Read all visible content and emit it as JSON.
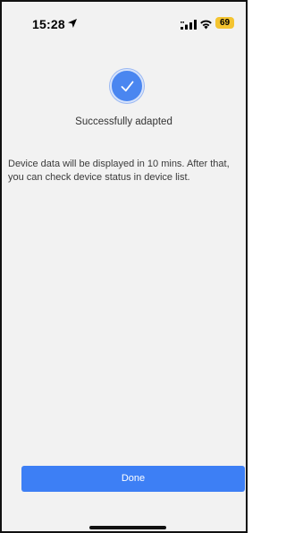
{
  "status_bar": {
    "time": "15:28",
    "battery_level": "69",
    "icons": [
      "location-arrow-icon",
      "cellular-signal-icon",
      "wifi-icon",
      "battery-icon"
    ],
    "battery_color": "#f4c430"
  },
  "result": {
    "icon": "checkmark-icon",
    "title": "Successfully adapted",
    "accent_color": "#4a86f0"
  },
  "message": {
    "body": "Device data will be displayed in 10 mins. After that, you can check device status in device list."
  },
  "actions": {
    "done_label": "Done",
    "button_color": "#3d7ff5"
  }
}
